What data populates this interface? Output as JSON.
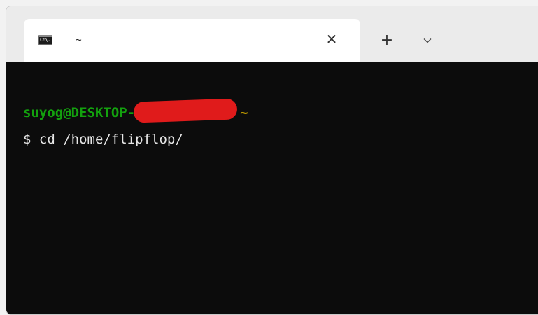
{
  "tabbar": {
    "tab": {
      "icon": "command-prompt-icon",
      "icon_text": "C:\\.",
      "title": "~",
      "close_symbol": "✕"
    },
    "new_tab_symbol": "+",
    "dropdown_icon": "chevron-down-icon"
  },
  "terminal": {
    "prompt_user_host": "suyog@DESKTOP-",
    "redacted_color": "#e01b1b",
    "prompt_cwd": "~",
    "command_line": "$ cd /home/flipflop/"
  },
  "colors": {
    "terminal_bg": "#0c0c0c",
    "user_host": "#13a10e",
    "cwd": "#c19c00",
    "text": "#e6e6e6"
  }
}
